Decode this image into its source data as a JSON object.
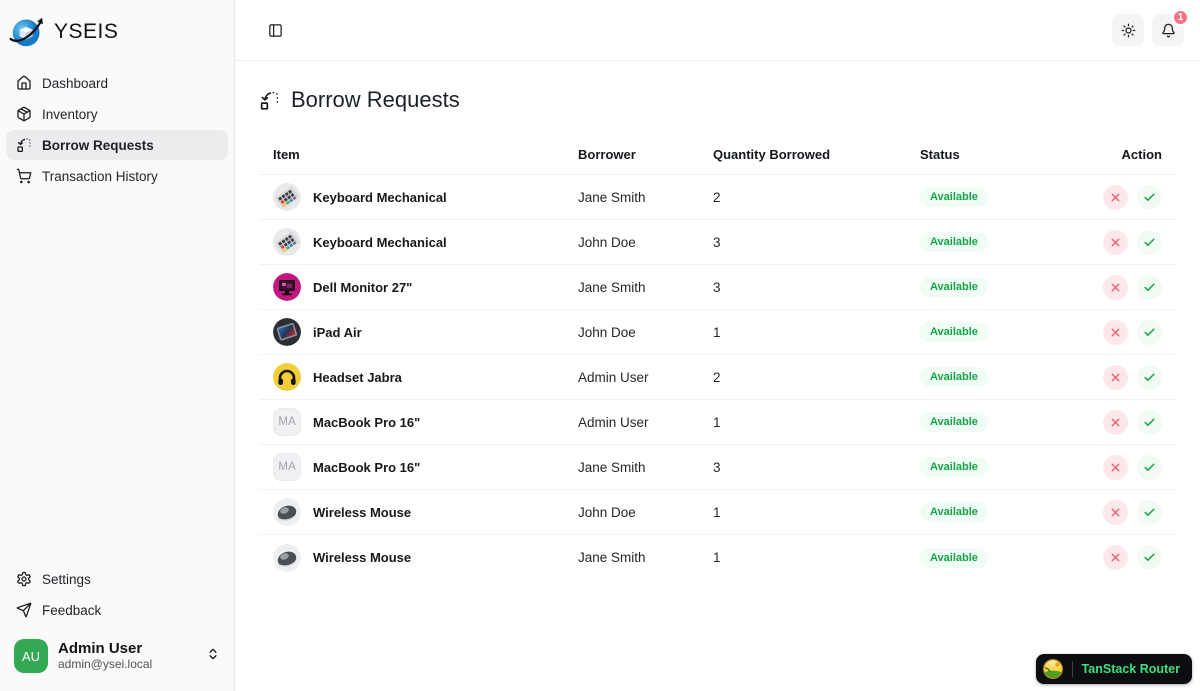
{
  "brand": {
    "name": "YSEIS"
  },
  "sidebar": {
    "items": [
      {
        "label": "Dashboard",
        "icon": "home-icon",
        "active": false
      },
      {
        "label": "Inventory",
        "icon": "package-icon",
        "active": false
      },
      {
        "label": "Borrow Requests",
        "icon": "borrow-requests-icon",
        "active": true
      },
      {
        "label": "Transaction History",
        "icon": "cart-icon",
        "active": false
      }
    ],
    "footer_items": [
      {
        "label": "Settings",
        "icon": "gear-icon"
      },
      {
        "label": "Feedback",
        "icon": "send-icon"
      }
    ],
    "user": {
      "initials": "AU",
      "name": "Admin User",
      "email": "admin@ysei.local"
    }
  },
  "header": {
    "notification_count": "1"
  },
  "page": {
    "title": "Borrow Requests"
  },
  "table": {
    "columns": [
      "Item",
      "Borrower",
      "Quantity Borrowed",
      "Status",
      "Action"
    ],
    "rows": [
      {
        "item": "Keyboard Mechanical",
        "thumb": "keyboard",
        "borrower": "Jane Smith",
        "quantity": "2",
        "status": "Available"
      },
      {
        "item": "Keyboard Mechanical",
        "thumb": "keyboard",
        "borrower": "John Doe",
        "quantity": "3",
        "status": "Available"
      },
      {
        "item": "Dell Monitor 27\"",
        "thumb": "monitor",
        "borrower": "Jane Smith",
        "quantity": "3",
        "status": "Available"
      },
      {
        "item": "iPad Air",
        "thumb": "ipad",
        "borrower": "John Doe",
        "quantity": "1",
        "status": "Available"
      },
      {
        "item": "Headset Jabra",
        "thumb": "headset",
        "borrower": "Admin User",
        "quantity": "2",
        "status": "Available"
      },
      {
        "item": "MacBook Pro 16\"",
        "thumb": "placeholder",
        "thumb_text": "MA",
        "borrower": "Admin User",
        "quantity": "1",
        "status": "Available"
      },
      {
        "item": "MacBook Pro 16\"",
        "thumb": "placeholder",
        "thumb_text": "MA",
        "borrower": "Jane Smith",
        "quantity": "3",
        "status": "Available"
      },
      {
        "item": "Wireless Mouse",
        "thumb": "mouse",
        "borrower": "John Doe",
        "quantity": "1",
        "status": "Available"
      },
      {
        "item": "Wireless Mouse",
        "thumb": "mouse",
        "borrower": "Jane Smith",
        "quantity": "1",
        "status": "Available"
      }
    ]
  },
  "devtools": {
    "label": "TanStack Router"
  },
  "colors": {
    "status_text": "#16a34a",
    "status_bg": "#f0fdf4",
    "reject": "#ef5f6e",
    "approve": "#16a34a",
    "notification": "#fb7185",
    "avatar": "#34a853",
    "sidebar_bg": "#fafafa",
    "devtools_label": "#3fe07c"
  }
}
